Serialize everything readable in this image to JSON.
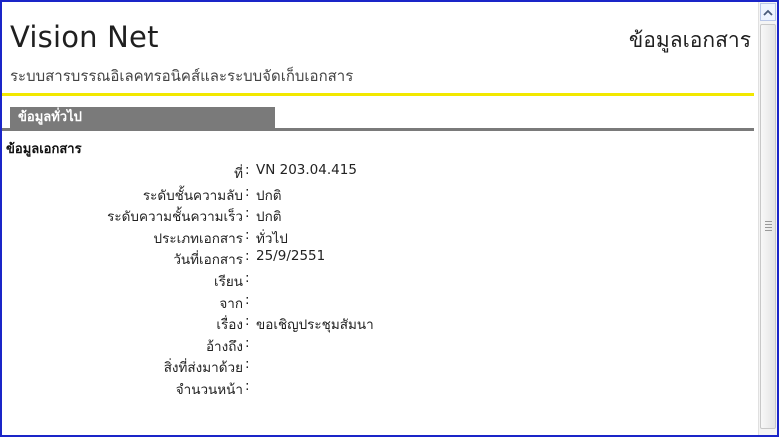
{
  "header": {
    "brand": "Vision Net",
    "doc_title": "ข้อมูลเอกสาร",
    "subtitle": "ระบบสารบรรณอิเลคทรอนิคส์และระบบจัดเก็บเอกสาร"
  },
  "tab": {
    "label": "ข้อมูลทั่วไป"
  },
  "section": {
    "title": "ข้อมูลเอกสาร"
  },
  "fields": [
    {
      "label": "ที่",
      "value": "VN 203.04.415"
    },
    {
      "label": "ระดับชั้นความลับ",
      "value": "ปกติ"
    },
    {
      "label": "ระดับความชั้นความเร็ว",
      "value": "ปกติ"
    },
    {
      "label": "ประเภทเอกสาร",
      "value": "ทั่วไป"
    },
    {
      "label": "วันที่เอกสาร",
      "value": "25/9/2551"
    },
    {
      "label": "เรียน",
      "value": ""
    },
    {
      "label": "จาก",
      "value": ""
    },
    {
      "label": "เรื่อง",
      "value": "ขอเชิญประชุมสัมนา"
    },
    {
      "label": "อ้างถึง",
      "value": ""
    },
    {
      "label": "สิ่งที่ส่งมาด้วย",
      "value": ""
    },
    {
      "label": "จำนวนหน้า",
      "value": ""
    }
  ],
  "colors": {
    "frame_border": "#1a25c8",
    "accent_rule": "#f2e800",
    "tab_bg": "#7a7a7a"
  },
  "icons": {
    "scroll_up": "chevron-up-icon",
    "scroll_grip": "grip-icon"
  }
}
